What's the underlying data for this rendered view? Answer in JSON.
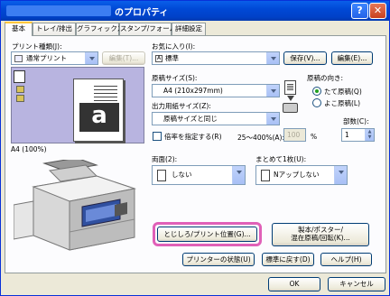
{
  "window": {
    "title": "のプロパティ",
    "help_glyph": "?",
    "close_glyph": "✕"
  },
  "tabs": [
    "基本",
    "トレイ/排出",
    "グラフィックス",
    "スタンプ/フォーム",
    "詳細設定"
  ],
  "print_type": {
    "label": "プリント種類(J):",
    "value": "通常プリント",
    "edit_button": "編集(T)..."
  },
  "favorites": {
    "label": "お気に入り(I):",
    "value": "標準",
    "save_button": "保存(V)...",
    "edit_button": "編集(E)..."
  },
  "original_size": {
    "label": "原稿サイズ(S):",
    "value": "A4 (210x297mm)"
  },
  "output_size": {
    "label": "出力用紙サイズ(Z):",
    "value": "原稿サイズと同じ"
  },
  "scale": {
    "checkbox_label": "倍率を指定する(R)",
    "range": "25〜400%(A):",
    "value": "100",
    "unit": "%"
  },
  "orientation": {
    "label": "原稿の向き:",
    "options": [
      "たて原稿(Q)",
      "よこ原稿(L)"
    ],
    "selected": 0
  },
  "copies": {
    "label": "部数(C):",
    "value": "1"
  },
  "preview": {
    "caption": "A4 (100%)",
    "letter": "a"
  },
  "duplex": {
    "label": "両面(2):",
    "value": "しない"
  },
  "nup": {
    "label": "まとめて1枚(U):",
    "value": "Nアップしない"
  },
  "buttons": {
    "binding": "とじしろ/プリント位置(G)...",
    "booklet_line1": "製本/ポスター/",
    "booklet_line2": "混在原稿/回転(K)...",
    "printer_status": "プリンターの状態(U)",
    "defaults": "標準に戻す(D)",
    "help": "ヘルプ(H)",
    "ok": "OK",
    "cancel": "キャンセル"
  },
  "colors": {
    "highlight": "#e060b8",
    "title_bar": "#0a5fe9",
    "face": "#ece9d8"
  }
}
